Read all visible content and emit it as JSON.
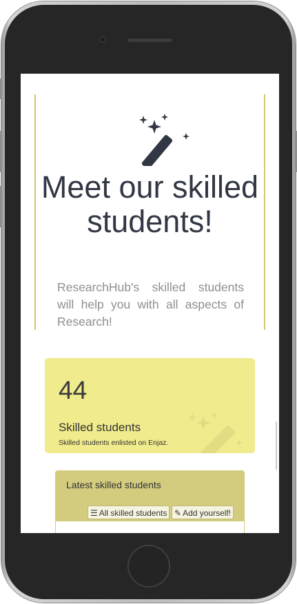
{
  "hero": {
    "icon": "magic-wand-icon",
    "title": "Meet our skilled students!",
    "description": "ResearchHub's skilled students will help you with all aspects of Research!"
  },
  "stats": {
    "count": "44",
    "label": "Skilled students",
    "description": "Skilled students enlisted on Enjaz.",
    "background_color": "#f0eb8c"
  },
  "latest": {
    "title": "Latest skilled students",
    "all_button": "All skilled students",
    "all_button_icon": "list-icon",
    "add_button": "Add yourself!",
    "add_button_icon": "paperclip-icon",
    "header_color": "#d3cc7e"
  },
  "colors": {
    "accent": "#d3c86a",
    "heading": "#313744",
    "body_text": "#8e8e8e"
  }
}
